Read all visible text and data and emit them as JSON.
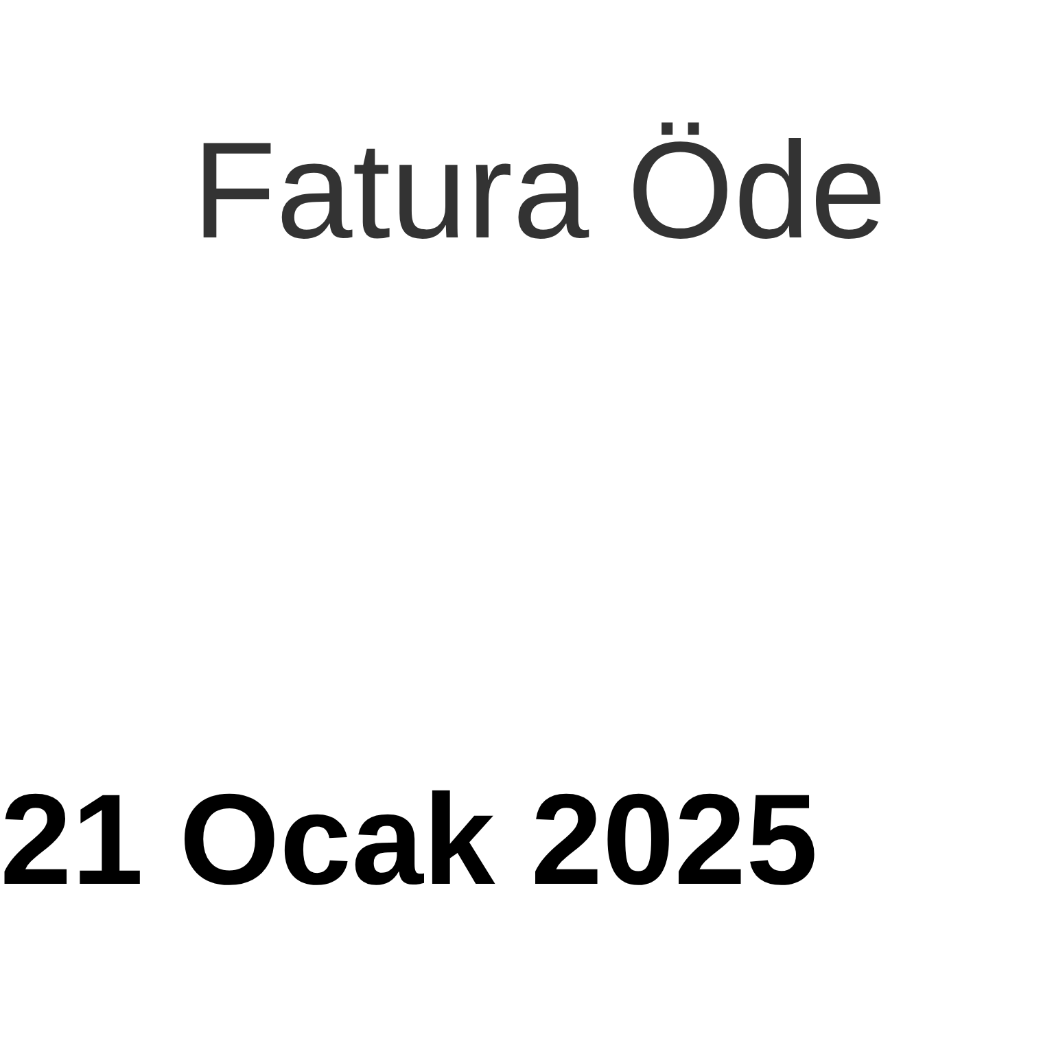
{
  "title": "Fatura Öde",
  "date": "21 Ocak 2025"
}
